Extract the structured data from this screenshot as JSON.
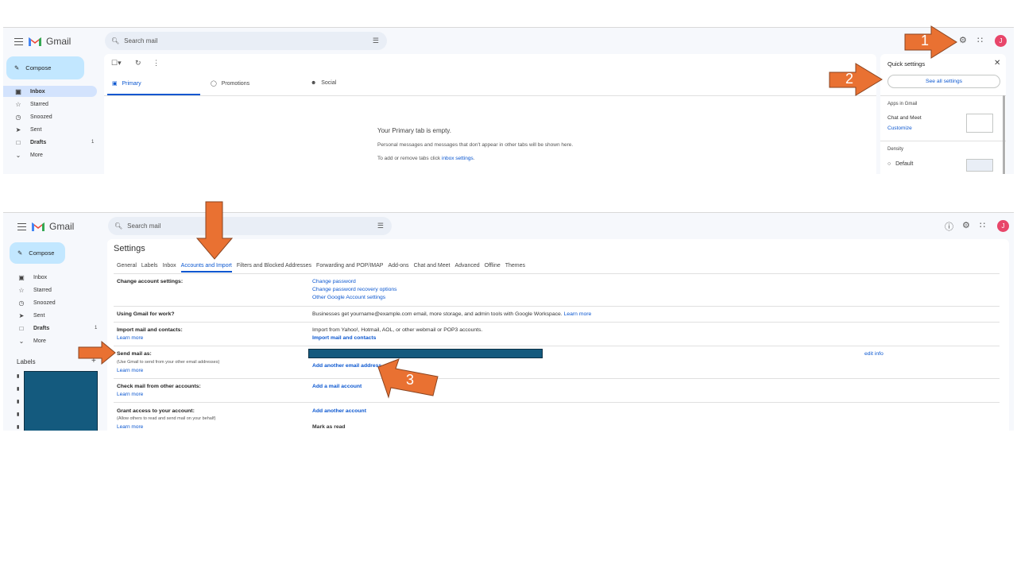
{
  "top": {
    "app_name": "Gmail",
    "search_placeholder": "Search mail",
    "compose": "Compose",
    "nav": [
      {
        "label": "Inbox",
        "count": ""
      },
      {
        "label": "Starred",
        "count": ""
      },
      {
        "label": "Snoozed",
        "count": ""
      },
      {
        "label": "Sent",
        "count": ""
      },
      {
        "label": "Drafts",
        "count": "1"
      },
      {
        "label": "More",
        "count": ""
      }
    ],
    "tabs": [
      "Primary",
      "Promotions",
      "Social"
    ],
    "empty_title": "Your Primary tab is empty.",
    "empty_line1": "Personal messages and messages that don't appear in other tabs will be shown here.",
    "empty_line2_prefix": "To add or remove tabs click",
    "empty_line2_link": "inbox settings",
    "empty_line2_suffix": ".",
    "quick": {
      "title": "Quick settings",
      "see_all": "See all settings",
      "apps_heading": "Apps in Gmail",
      "chat_meet": "Chat and Meet",
      "customize": "Customize",
      "density": "Density",
      "default": "Default"
    },
    "avatar": "J"
  },
  "bottom": {
    "app_name": "Gmail",
    "search_placeholder": "Search mail",
    "compose": "Compose",
    "nav": [
      {
        "label": "Inbox",
        "count": ""
      },
      {
        "label": "Starred",
        "count": ""
      },
      {
        "label": "Snoozed",
        "count": ""
      },
      {
        "label": "Sent",
        "count": ""
      },
      {
        "label": "Drafts",
        "count": "1"
      },
      {
        "label": "More",
        "count": ""
      }
    ],
    "labels_heading": "Labels",
    "labels_add": "+",
    "settings_title": "Settings",
    "tabs": [
      "General",
      "Labels",
      "Inbox",
      "Accounts and Import",
      "Filters and Blocked Addresses",
      "Forwarding and POP/IMAP",
      "Add-ons",
      "Chat and Meet",
      "Advanced",
      "Offline",
      "Themes"
    ],
    "rows": {
      "change_account": {
        "label": "Change account settings:",
        "links": [
          "Change password",
          "Change password recovery options",
          "Other Google Account settings"
        ]
      },
      "work": {
        "label": "Using Gmail for work?",
        "text": "Businesses get yourname@example.com email, more storage, and admin tools with Google Workspace.",
        "link": "Learn more"
      },
      "import": {
        "label": "Import mail and contacts:",
        "learn": "Learn more",
        "text": "Import from Yahoo!, Hotmail, AOL, or other webmail or POP3 accounts.",
        "action": "Import mail and contacts"
      },
      "send_as": {
        "label": "Send mail as:",
        "hint": "(Use Gmail to send from your other email addresses)",
        "learn": "Learn more",
        "action": "Add another email address",
        "edit": "edit info"
      },
      "check": {
        "label": "Check mail from other accounts:",
        "learn": "Learn more",
        "action": "Add a mail account"
      },
      "grant": {
        "label": "Grant access to your account:",
        "hint": "(Allow others to read and send mail on your behalf)",
        "learn": "Learn more",
        "action": "Add another account",
        "mark": "Mark as read"
      }
    },
    "avatar": "J"
  },
  "callouts": [
    "1",
    "2",
    "3"
  ],
  "colors": {
    "arrow": "#e97132",
    "redaction": "#145a7e",
    "accent": "#0b57d0"
  }
}
